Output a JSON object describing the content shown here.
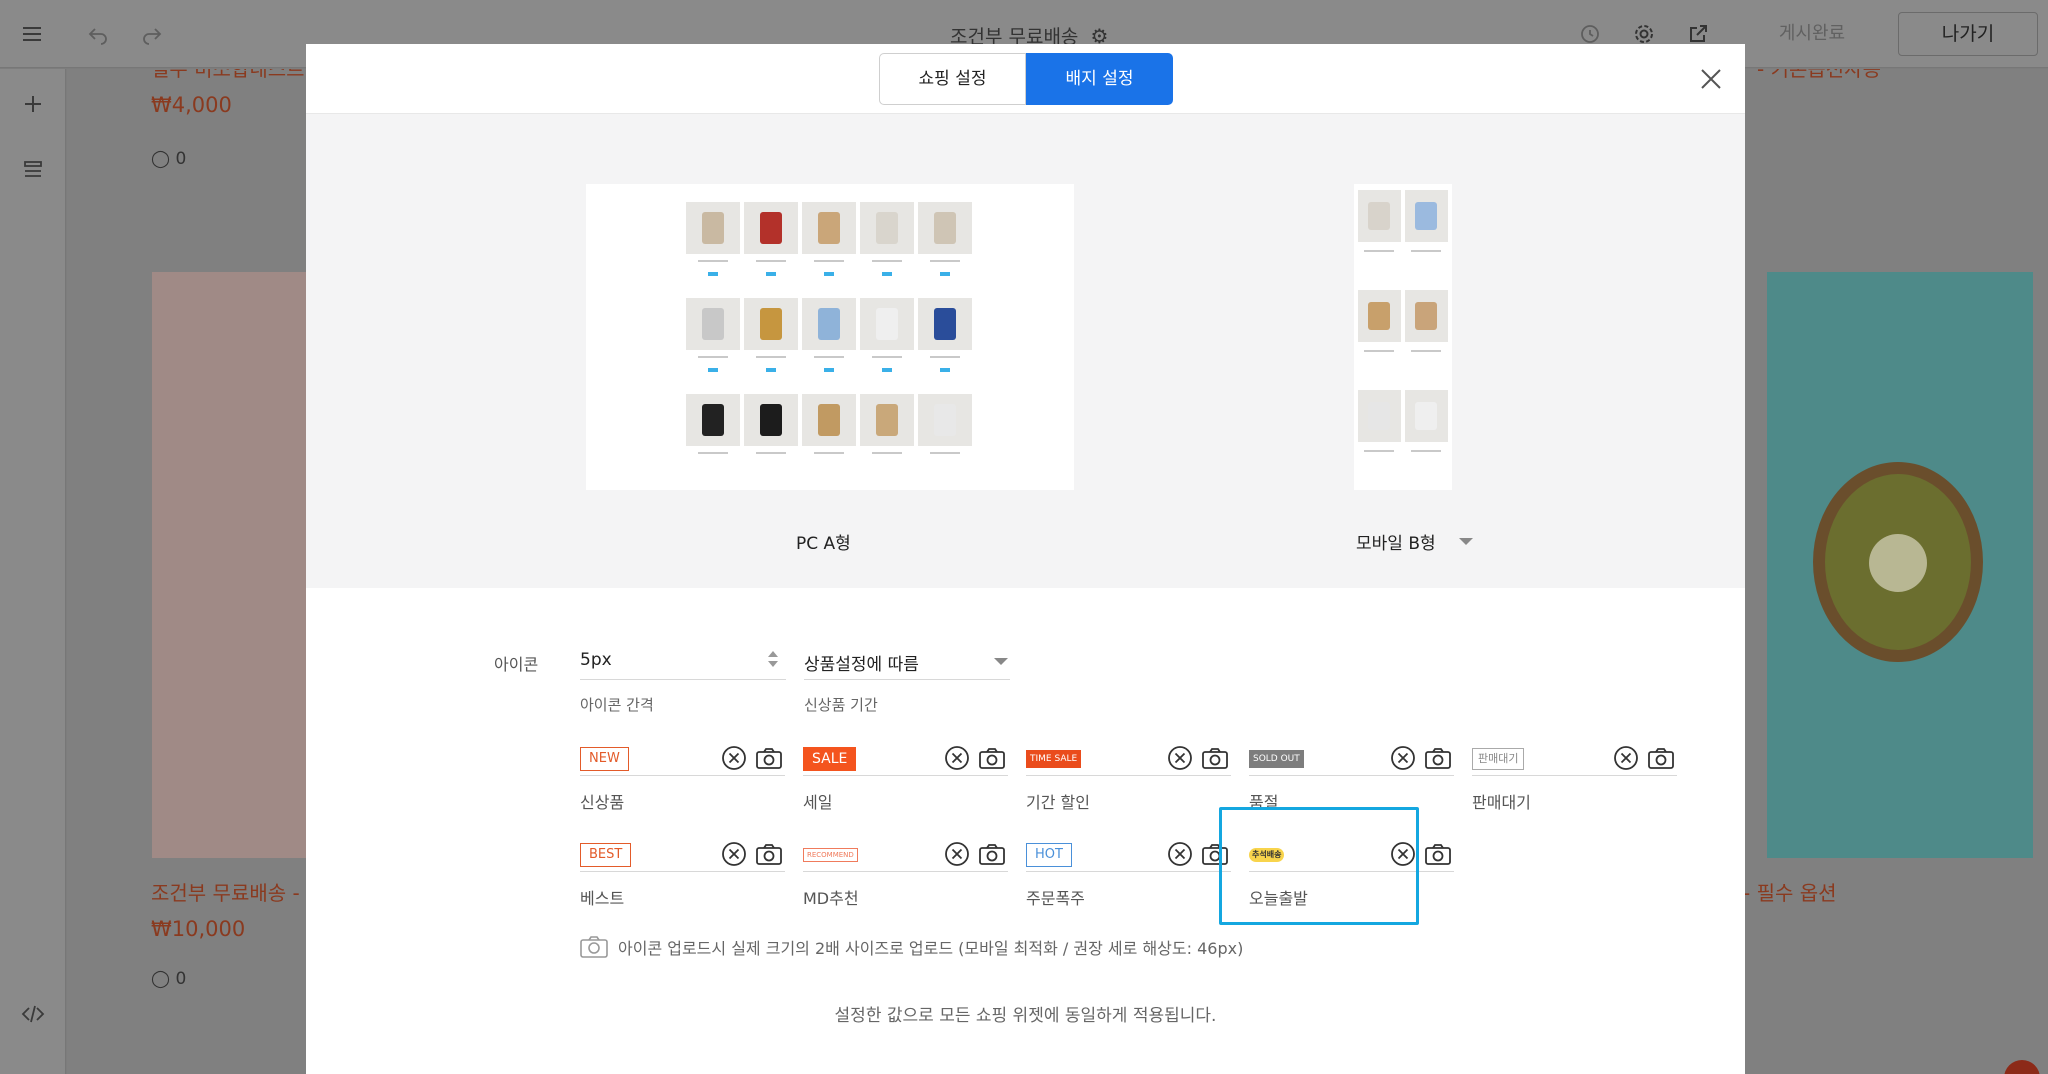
{
  "editor": {
    "title": "조건부 무료배송",
    "published_label": "게시완료",
    "exit_label": "나가기",
    "icons": [
      "menu-icon",
      "undo-icon",
      "redo-icon",
      "gear-icon",
      "history-icon",
      "settings-icon",
      "external-link-icon",
      "plus-icon",
      "layers-icon",
      "code-icon"
    ]
  },
  "background": {
    "top_left_title": "필수 비소합네스트",
    "top_right_title": "- 기본옵션사용",
    "price_top": "₩4,000",
    "comments_top": "0",
    "product_left_title": "조건부 무료배송 - ",
    "product_right_title": "- 필수 옵션",
    "price_bottom": "₩10,000",
    "comments_bottom": "0"
  },
  "modal": {
    "tabs": [
      {
        "label": "쇼핑 설정",
        "active": false
      },
      {
        "label": "배지 설정",
        "active": true
      }
    ],
    "preview": {
      "pc_label": "PC A형",
      "mobile_label": "모바일 B형"
    },
    "icon_section_label": "아이콘",
    "spacing": {
      "value": "5px",
      "caption": "아이콘 간격"
    },
    "new_period": {
      "value": "상품설정에 따름",
      "caption": "신상품 기간"
    },
    "badges": [
      {
        "badge_text": "NEW",
        "caption": "신상품",
        "style": "new"
      },
      {
        "badge_text": "SALE",
        "caption": "세일",
        "style": "sale"
      },
      {
        "badge_text": "TIME SALE",
        "caption": "기간 할인",
        "style": "timesale"
      },
      {
        "badge_text": "SOLD OUT",
        "caption": "품절",
        "style": "soldout"
      },
      {
        "badge_text": "판매대기",
        "caption": "판매대기",
        "style": "wait"
      },
      {
        "badge_text": "BEST",
        "caption": "베스트",
        "style": "best"
      },
      {
        "badge_text": "RECOMMEND",
        "caption": "MD추천",
        "style": "recommend"
      },
      {
        "badge_text": "HOT",
        "caption": "주문폭주",
        "style": "hot"
      },
      {
        "badge_text": "추석배송",
        "caption": "오늘출발",
        "style": "today"
      }
    ],
    "upload_note": "아이콘 업로드시 실제 크기의 2배 사이즈로 업로드 (모바일 최적화 / 권장 세로 해상도: 46px)",
    "bottom_note": "설정한 값으로 모든 쇼핑 위젯에 동일하게 적용됩니다."
  },
  "colors": {
    "accent": "#1a73e8",
    "highlight": "#14a7e0",
    "brand_red": "#f4541e"
  }
}
